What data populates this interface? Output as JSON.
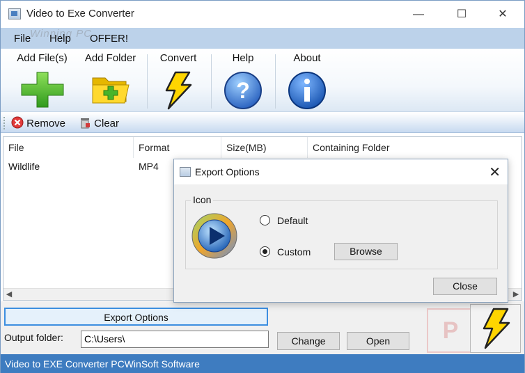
{
  "window": {
    "title": "Video to Exe Converter",
    "watermark": "Winning PC",
    "controls": {
      "minimize": "—",
      "maximize": "☐",
      "close": "✕"
    }
  },
  "menu": {
    "items": [
      "File",
      "Help",
      "OFFER!"
    ]
  },
  "toolbar": {
    "add_files": "Add File(s)",
    "add_folder": "Add Folder",
    "convert": "Convert",
    "help": "Help",
    "about": "About"
  },
  "subbar": {
    "remove": "Remove",
    "clear": "Clear"
  },
  "filelist": {
    "columns": [
      "File",
      "Format",
      "Size(MB)",
      "Containing Folder"
    ],
    "rows": [
      {
        "file": "Wildlife",
        "format": "MP4",
        "size": "",
        "folder": ""
      }
    ]
  },
  "bottom": {
    "export_options": "Export Options",
    "output_label": "Output folder:",
    "output_value": "C:\\Users\\",
    "change": "Change",
    "open": "Open"
  },
  "status": {
    "text": "Video to EXE Converter  PCWinSoft Software"
  },
  "dialog": {
    "title": "Export Options",
    "close_glyph": "✕",
    "group": "Icon",
    "default_label": "Default",
    "custom_label": "Custom",
    "selected": "Custom",
    "browse": "Browse",
    "close": "Close"
  },
  "colors": {
    "accent": "#3e7cc0",
    "menu_bg": "#bcd2ea",
    "dialog_bg": "#f0f0f0"
  }
}
